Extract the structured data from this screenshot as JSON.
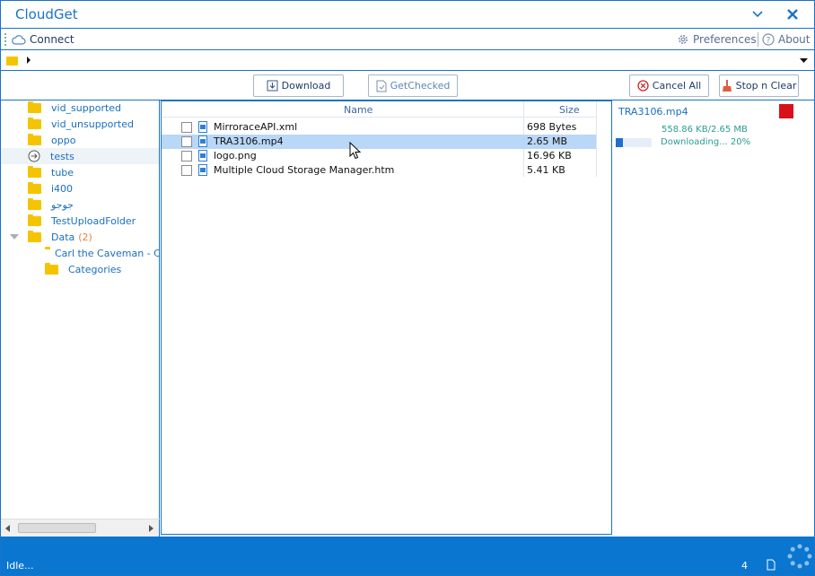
{
  "app": {
    "title": "CloudGet"
  },
  "menu": {
    "connect": "Connect",
    "preferences": "Preferences",
    "about": "About"
  },
  "toolbar": {
    "download": "Download",
    "get_checked": "GetChecked",
    "cancel_all": "Cancel All",
    "stop_clear": "Stop n Clear"
  },
  "tree": {
    "items": [
      {
        "label": "vid_supported"
      },
      {
        "label": "vid_unsupported"
      },
      {
        "label": "oppo"
      },
      {
        "label": "tests"
      },
      {
        "label": "tube"
      },
      {
        "label": "i400"
      },
      {
        "label": "جوجو"
      },
      {
        "label": "TestUploadFolder"
      },
      {
        "label": "Data",
        "count": "(2)"
      },
      {
        "label": "Carl the Caveman - C"
      },
      {
        "label": "Categories"
      }
    ]
  },
  "files": {
    "columns": {
      "name": "Name",
      "size": "Size"
    },
    "rows": [
      {
        "name": "MirroraceAPI.xml",
        "size": "698 Bytes"
      },
      {
        "name": "TRA3106.mp4",
        "size": "2.65 MB"
      },
      {
        "name": "logo.png",
        "size": "16.96 KB"
      },
      {
        "name": "Multiple Cloud Storage Manager.htm",
        "size": "5.41 KB"
      }
    ]
  },
  "download": {
    "file": "TRA3106.mp4",
    "progress_text": "558.86 KB/2.65 MB",
    "status_text": "Downloading... 20%",
    "progress": 0.2
  },
  "status": {
    "text": "Idle...",
    "count": "4"
  },
  "colors": {
    "accent": "#1a73c6",
    "status_bar": "#0a76d0",
    "stop": "#d8101b",
    "folder": "#f5c400"
  }
}
